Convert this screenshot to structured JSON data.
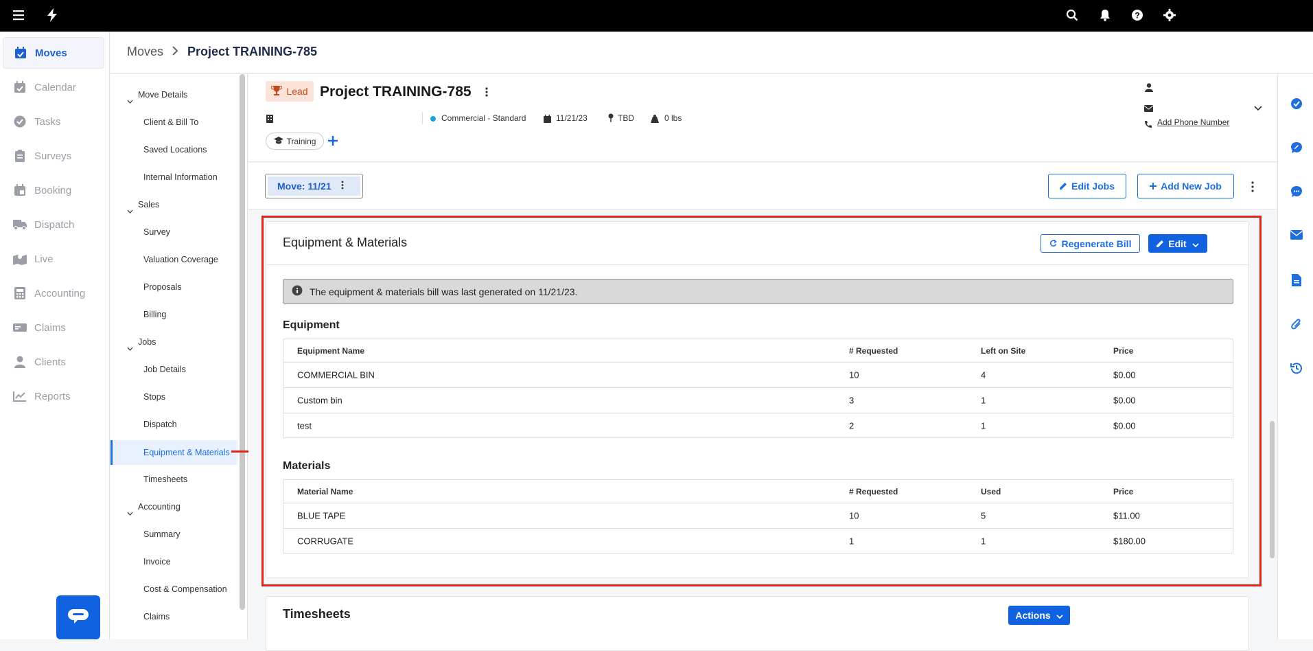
{
  "topbar": {
    "icons": [
      "menu-icon",
      "logo-bolt",
      "search-icon",
      "bell-icon",
      "help-icon",
      "gear-icon"
    ]
  },
  "sidenav": {
    "items": [
      {
        "label": "Moves",
        "icon": "calendar-check-icon",
        "active": true
      },
      {
        "label": "Calendar",
        "icon": "calendar-icon"
      },
      {
        "label": "Tasks",
        "icon": "check-circle-icon"
      },
      {
        "label": "Surveys",
        "icon": "clipboard-icon"
      },
      {
        "label": "Booking",
        "icon": "calendar-book-icon"
      },
      {
        "label": "Dispatch",
        "icon": "truck-icon"
      },
      {
        "label": "Live",
        "icon": "map-icon"
      },
      {
        "label": "Accounting",
        "icon": "calculator-icon"
      },
      {
        "label": "Claims",
        "icon": "ticket-icon"
      },
      {
        "label": "Clients",
        "icon": "user-icon"
      },
      {
        "label": "Reports",
        "icon": "chart-line-icon"
      }
    ]
  },
  "breadcrumb": {
    "root": "Moves",
    "current": "Project TRAINING-785"
  },
  "subnav": {
    "sections": [
      {
        "label": "Move Details",
        "children": [
          "Client & Bill To",
          "Saved Locations",
          "Internal Information"
        ]
      },
      {
        "label": "Sales",
        "children": [
          "Survey",
          "Valuation Coverage",
          "Proposals",
          "Billing"
        ]
      },
      {
        "label": "Jobs",
        "children": [
          "Job Details",
          "Stops",
          "Dispatch",
          "Equipment & Materials",
          "Timesheets"
        ]
      },
      {
        "label": "Accounting",
        "children": [
          "Summary",
          "Invoice",
          "Cost & Compensation",
          "Claims"
        ]
      }
    ],
    "selected": "Equipment & Materials"
  },
  "project": {
    "badge": "Lead",
    "title": "Project TRAINING-785",
    "type": "Commercial - Standard",
    "date": "11/21/23",
    "location": "TBD",
    "weight": "0 lbs",
    "tag": "Training",
    "add_phone": "Add Phone Number"
  },
  "move_tab": "Move: 11/21",
  "actions": {
    "edit_jobs": "Edit Jobs",
    "add_new_job": "Add New Job"
  },
  "equipment_card": {
    "title": "Equipment & Materials",
    "regenerate": "Regenerate Bill",
    "edit": "Edit",
    "info": "The equipment & materials bill was last generated on 11/21/23.",
    "equipment_title": "Equipment",
    "equipment_headers": [
      "Equipment Name",
      "# Requested",
      "Left on Site",
      "Price"
    ],
    "equipment_rows": [
      [
        "COMMERCIAL BIN",
        "10",
        "4",
        "$0.00"
      ],
      [
        "Custom bin",
        "3",
        "1",
        "$0.00"
      ],
      [
        "test",
        "2",
        "1",
        "$0.00"
      ]
    ],
    "materials_title": "Materials",
    "materials_headers": [
      "Material Name",
      "# Requested",
      "Used",
      "Price"
    ],
    "materials_rows": [
      [
        "BLUE TAPE",
        "10",
        "5",
        "$11.00"
      ],
      [
        "CORRUGATE",
        "1",
        "1",
        "$180.00"
      ]
    ]
  },
  "timesheets": {
    "title": "Timesheets",
    "actions": "Actions"
  },
  "colors": {
    "accent": "#1062e0",
    "highlight": "#e0241b",
    "lead_badge_bg": "#fbe3da",
    "lead_badge_fg": "#c44a1c"
  }
}
